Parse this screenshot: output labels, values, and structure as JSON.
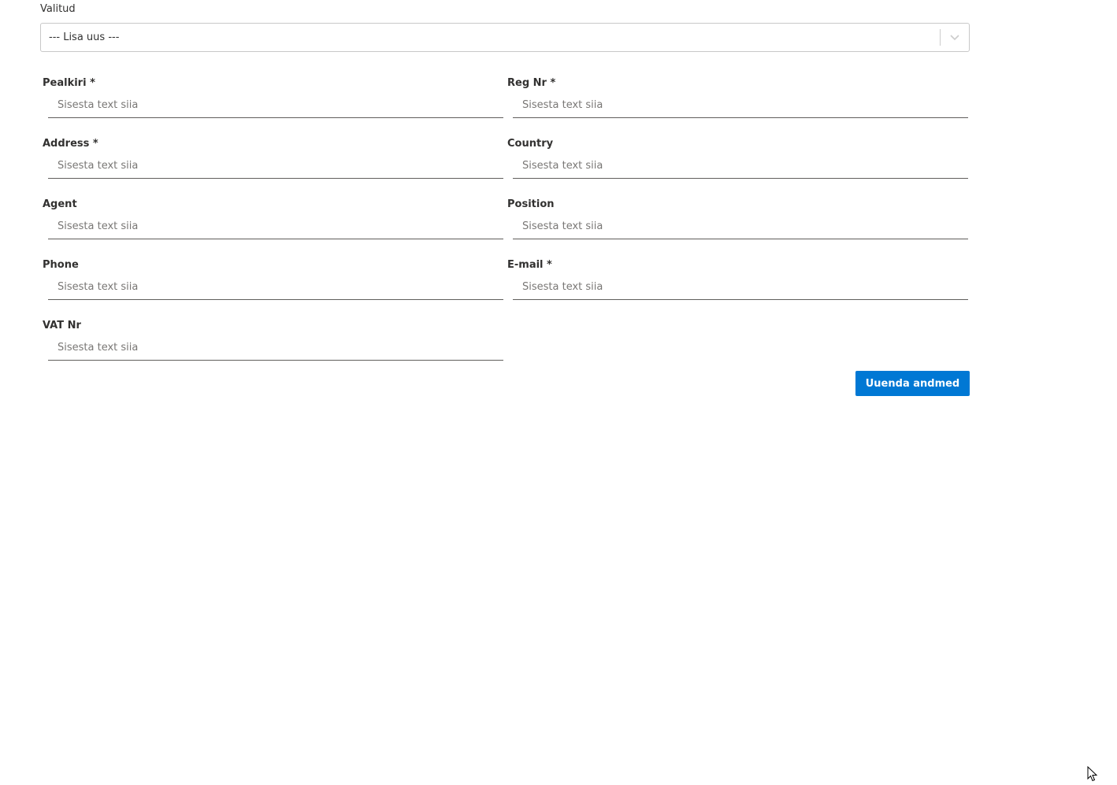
{
  "selector": {
    "label": "Valitud",
    "value": "--- Lisa uus ---",
    "icon": "chevron-down-icon"
  },
  "fields": {
    "pealkiri": {
      "label": "Pealkiri *",
      "placeholder": "Sisesta text siia",
      "value": ""
    },
    "reg_nr": {
      "label": "Reg Nr *",
      "placeholder": "Sisesta text siia",
      "value": ""
    },
    "address": {
      "label": "Address *",
      "placeholder": "Sisesta text siia",
      "value": ""
    },
    "country": {
      "label": "Country",
      "placeholder": "Sisesta text siia",
      "value": ""
    },
    "agent": {
      "label": "Agent",
      "placeholder": "Sisesta text siia",
      "value": ""
    },
    "position": {
      "label": "Position",
      "placeholder": "Sisesta text siia",
      "value": ""
    },
    "phone": {
      "label": "Phone",
      "placeholder": "Sisesta text siia",
      "value": ""
    },
    "email": {
      "label": "E-mail *",
      "placeholder": "Sisesta text siia",
      "value": ""
    },
    "vat_nr": {
      "label": "VAT Nr",
      "placeholder": "Sisesta text siia",
      "value": ""
    }
  },
  "actions": {
    "submit_label": "Uuenda andmed"
  },
  "colors": {
    "accent": "#0078d4",
    "input_border": "#605e5c",
    "placeholder": "#797775"
  }
}
